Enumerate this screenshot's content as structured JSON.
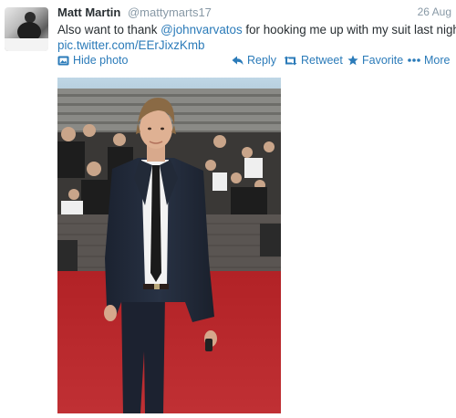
{
  "tweet": {
    "author_name": "Matt Martin",
    "author_handle": "@mattymarts17",
    "date": "26 Aug",
    "text_line1_prefix": "Also want to thank ",
    "text_line1_mention": "@johnvarvatos",
    "text_line1_suffix": " for hooking me up with my suit last night",
    "media_link": "pic.twitter.com/EErJixzKmb"
  },
  "actions": {
    "hide_photo": "Hide photo",
    "reply": "Reply",
    "retweet": "Retweet",
    "favorite": "Favorite",
    "more": "More"
  },
  "icons": {
    "hide_photo": "photo-icon",
    "reply": "reply-arrow-icon",
    "retweet": "retweet-icon",
    "favorite": "star-icon",
    "more": "ellipsis-icon"
  },
  "colors": {
    "link": "#2b7bb9",
    "name": "#292f33",
    "muted": "#8899a6",
    "carpet": "#b8262a"
  }
}
